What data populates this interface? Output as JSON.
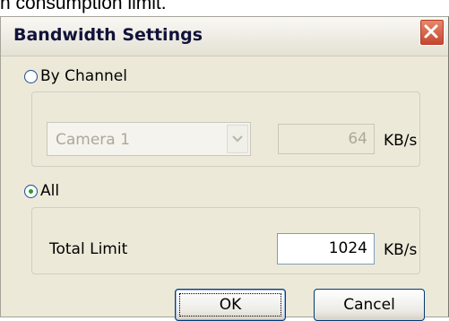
{
  "background_caption": "h consumption limit.",
  "dialog": {
    "title": "Bandwidth Settings"
  },
  "by_channel": {
    "label": "By Channel",
    "selected": false,
    "camera_value": "Camera 1",
    "value": "64",
    "unit": "KB/s"
  },
  "all": {
    "label": "All",
    "selected": true,
    "total_limit_label": "Total Limit",
    "value": "1024",
    "unit": "KB/s"
  },
  "buttons": {
    "ok": "OK",
    "cancel": "Cancel"
  },
  "colors": {
    "window_bg": "#ece9d8",
    "title_text": "#11123a",
    "close_button": "#c54530",
    "radio_dot": "#22a12e"
  },
  "icons": [
    "close-icon",
    "chevron-down-icon",
    "radio-icon"
  ]
}
